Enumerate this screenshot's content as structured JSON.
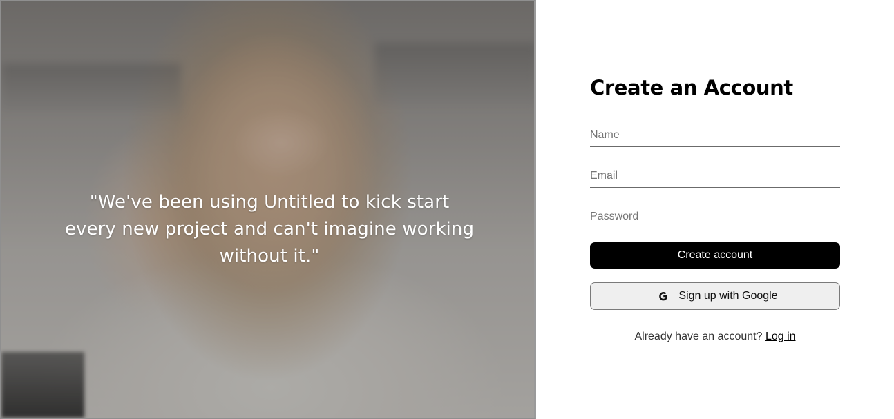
{
  "hero": {
    "quote": "\"We've been using Untitled to kick start every new project and can't imagine working without it.\""
  },
  "form": {
    "title": "Create an Account",
    "name_placeholder": "Name",
    "email_placeholder": "Email",
    "password_placeholder": "Password",
    "submit_label": "Create account",
    "google_label": "Sign up with Google",
    "google_icon": "google-g-icon",
    "footer_text": "Already have an account?",
    "login_link": "Log in"
  }
}
